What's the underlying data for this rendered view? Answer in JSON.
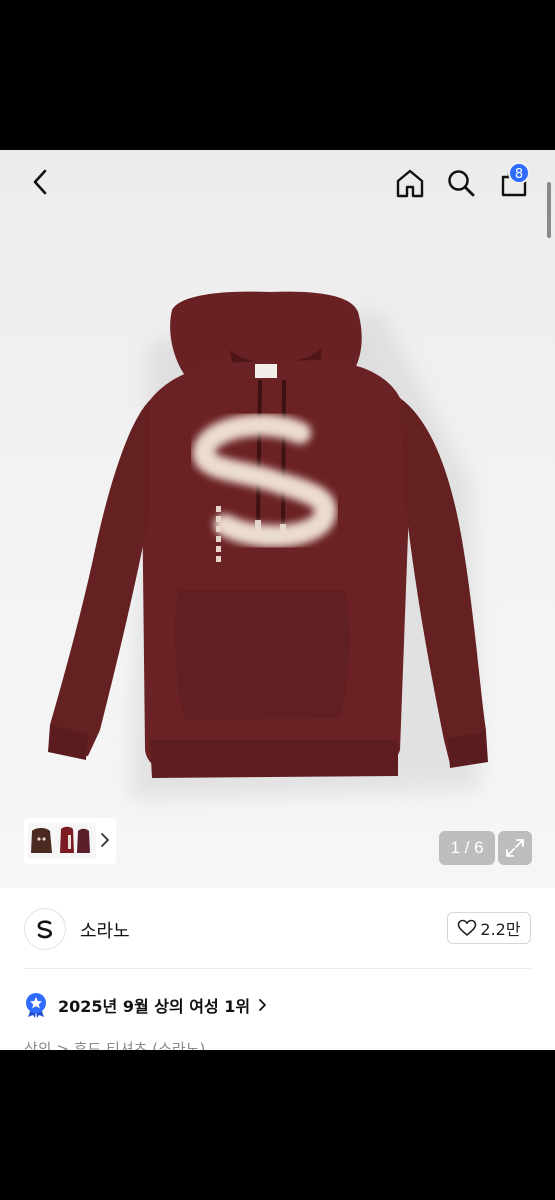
{
  "header": {
    "back_icon": "chevron-left-icon",
    "home_icon": "home-icon",
    "search_icon": "search-icon",
    "cart_icon": "shopping-bag-icon",
    "cart_count": "8"
  },
  "gallery": {
    "page_counter": "1 / 6",
    "expand_icon": "expand-icon",
    "thumbnail_chevron_icon": "chevron-right-icon"
  },
  "brand": {
    "name": "소라노",
    "logo_letter": "S",
    "like_count": "2.2만",
    "like_icon": "heart-icon"
  },
  "ranking": {
    "text": "2025년 9월 상의 여성 1위",
    "badge_icon": "medal-star-icon",
    "badge_color": "#2f6bff"
  },
  "breadcrumb": {
    "text": "상의 > 후드 티셔츠 (소라노)"
  },
  "colors": {
    "accent": "#2f6bff",
    "product": "#6b2224"
  }
}
